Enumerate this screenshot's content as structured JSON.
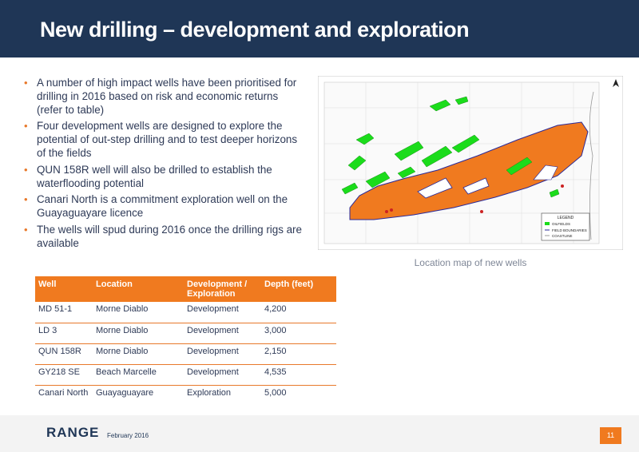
{
  "slide": {
    "title": "New drilling – development  and exploration",
    "bullets": [
      "A number of high impact wells have been prioritised for drilling in 2016 based on risk and economic returns (refer to table)",
      "Four development wells are designed to explore the potential of out-step drilling and to test deeper horizons of the fields",
      "QUN 158R well will also be drilled to establish the waterflooding potential",
      "Canari North is a commitment exploration well on the Guayaguayare licence",
      "The wells will spud during 2016 once the drilling rigs are available"
    ],
    "bullet_marker": "•"
  },
  "map": {
    "caption": "Location map of new wells",
    "legend": {
      "title": "LEGEND",
      "items": [
        "OILFIELDS",
        "FIELD BOUNDARIES",
        "COASTLINE"
      ]
    },
    "colors": {
      "field": "#f07a1f",
      "land": "#1bdc1b",
      "boundary": "#2a2a9a"
    }
  },
  "table": {
    "headers": [
      "Well",
      "Location",
      "Development / Exploration",
      "Depth (feet)"
    ],
    "rows": [
      [
        "MD 51-1",
        "Morne Diablo",
        "Development",
        "4,200"
      ],
      [
        "LD 3",
        "Morne Diablo",
        "Development",
        "3,000"
      ],
      [
        "QUN 158R",
        "Morne Diablo",
        "Development",
        "2,150"
      ],
      [
        "GY218 SE",
        "Beach Marcelle",
        "Development",
        "4,535"
      ],
      [
        "Canari North",
        "Guayaguayare",
        "Exploration",
        "5,000"
      ]
    ]
  },
  "footer": {
    "logo": "RANGE",
    "date": "February 2016",
    "page": "11"
  },
  "colors": {
    "header": "#1f3656",
    "accent": "#f07a1f",
    "text": "#2e3a57"
  }
}
